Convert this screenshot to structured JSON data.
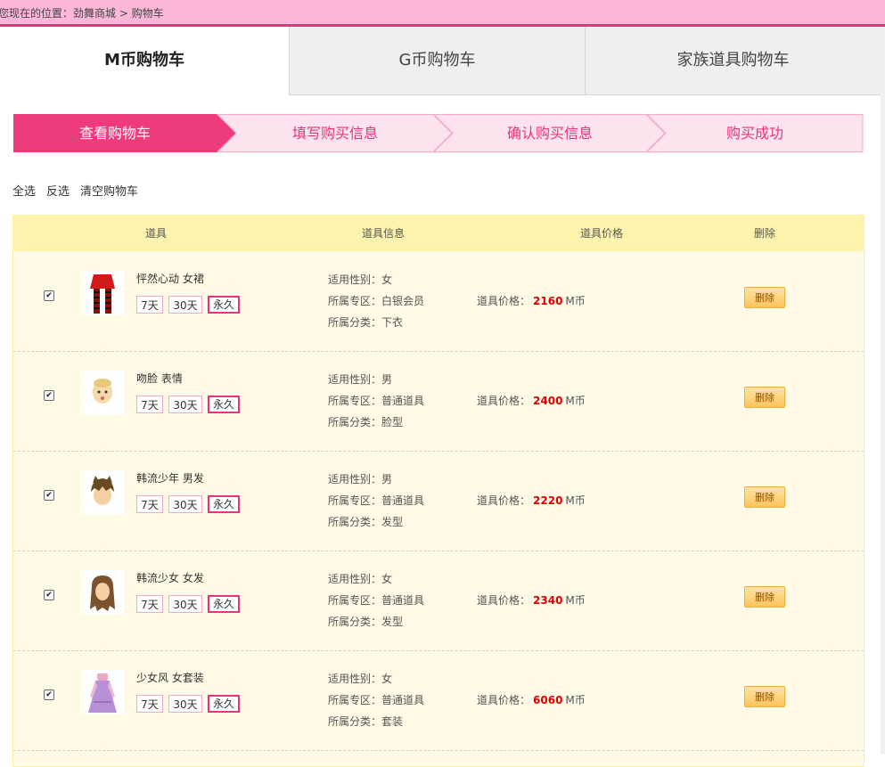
{
  "breadcrumb": "您现在的位置：劲舞商城 > 购物车",
  "tabs": [
    "M币购物车",
    "G币购物车",
    "家族道具购物车"
  ],
  "steps": [
    "查看购物车",
    "填写购买信息",
    "确认购买信息",
    "购买成功"
  ],
  "actions": {
    "select_all": "全选",
    "invert": "反选",
    "clear": "清空购物车"
  },
  "columns": {
    "item": "道具",
    "info": "道具信息",
    "price": "道具价格",
    "delete": "删除"
  },
  "labels": {
    "gender": "适用性别：",
    "zone": "所属专区：",
    "category": "所属分类：",
    "price_prefix": "道具价格：",
    "currency": "M币",
    "delete_button": "删除"
  },
  "durations": [
    "7天",
    "30天",
    "永久"
  ],
  "colors": {
    "accent": "#e8337a",
    "header_bg": "#fcb6d8",
    "table_bg": "#fffbe6",
    "table_head": "#fdf3ad",
    "price": "#e00000"
  },
  "items": [
    {
      "name": "怦然心动 女裙",
      "gender": "女",
      "zone": "白银会员",
      "category": "下衣",
      "price": "2160",
      "checked": true,
      "selected_duration": "永久",
      "icon": "red-skirt-icon"
    },
    {
      "name": "吻脸 表情",
      "gender": "男",
      "zone": "普通道具",
      "category": "脸型",
      "price": "2400",
      "checked": true,
      "selected_duration": "永久",
      "icon": "kiss-face-icon"
    },
    {
      "name": "韩流少年 男发",
      "gender": "男",
      "zone": "普通道具",
      "category": "发型",
      "price": "2220",
      "checked": true,
      "selected_duration": "永久",
      "icon": "male-hair-icon"
    },
    {
      "name": "韩流少女 女发",
      "gender": "女",
      "zone": "普通道具",
      "category": "发型",
      "price": "2340",
      "checked": true,
      "selected_duration": "永久",
      "icon": "female-hair-icon"
    },
    {
      "name": "少女风 女套装",
      "gender": "女",
      "zone": "普通道具",
      "category": "套装",
      "price": "6060",
      "checked": true,
      "selected_duration": "永久",
      "icon": "girl-outfit-icon"
    }
  ]
}
